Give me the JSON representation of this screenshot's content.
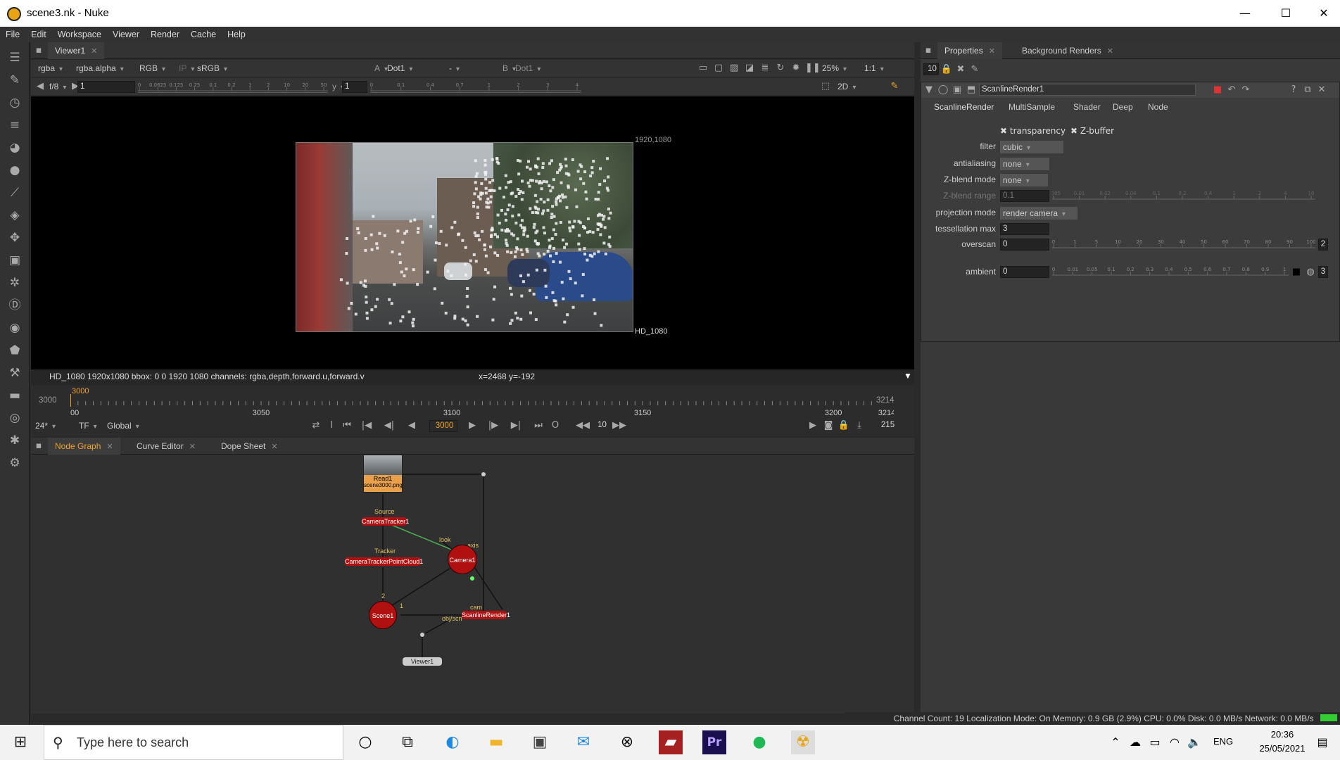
{
  "window": {
    "title": "scene3.nk - Nuke",
    "minimize": "—",
    "maximize": "☐",
    "close": "✕"
  },
  "menu": [
    "File",
    "Edit",
    "Workspace",
    "Viewer",
    "Render",
    "Cache",
    "Help"
  ],
  "viewer_tab": {
    "label": "Viewer1",
    "close": "✕"
  },
  "viewer_controls": {
    "channels": "rgba",
    "alpha": "rgba.alpha",
    "display": "RGB",
    "ip": "IP",
    "lut": "sRGB",
    "a_label": "A",
    "a_input": "Dot1",
    "mid": "-",
    "b_label": "B",
    "b_input": "Dot1",
    "zoom": "25%",
    "ratio": "1:1",
    "fstop": "f/8",
    "gain": "1",
    "gamma_label": "y",
    "gamma": "1",
    "mode": "2D"
  },
  "gain_ticks": [
    "0",
    "0.0625",
    "0.125",
    "0.25",
    "0.1",
    "0.2",
    "1",
    "2",
    "10",
    "20",
    "50"
  ],
  "gamma_ticks": [
    "0",
    "0.1",
    "0.4",
    "0.7",
    "1",
    "2",
    "3",
    "4"
  ],
  "viewer": {
    "res_top": "1920,1080",
    "res_bottom": "HD_1080"
  },
  "status": {
    "info": "HD_1080 1920x1080  bbox: 0 0 1920 1080 channels: rgba,depth,forward.u,forward.v",
    "coords": "x=2468 y=-192"
  },
  "timeline": {
    "start": "3000",
    "end": "3214",
    "current": "3000",
    "ticks": [
      "3000",
      "3050",
      "3100",
      "3150",
      "3200",
      "3214"
    ],
    "fps": "24*",
    "tf": "TF",
    "global": "Global",
    "frame": "3000",
    "step": "10",
    "total": "215",
    "in_marker": "I",
    "out_marker": "O"
  },
  "graph_tabs": [
    {
      "label": "Node Graph",
      "close": "✕"
    },
    {
      "label": "Curve Editor",
      "close": "✕"
    },
    {
      "label": "Dope Sheet",
      "close": "✕"
    }
  ],
  "nodes": {
    "read": "Read1",
    "read_file": "scene3000.png",
    "tracker": "CameraTracker1",
    "pointcloud": "CameraTrackerPointCloud1",
    "camera": "Camera1",
    "scene": "Scene1",
    "render": "ScanlineRender1",
    "viewer": "Viewer1",
    "lbl_source": "Source",
    "lbl_tracker": "Tracker",
    "lbl_look": "look",
    "lbl_axis": "axis",
    "lbl_cam": "cam",
    "lbl_obj": "obj/scn",
    "lbl_2": "2",
    "lbl_1": "1"
  },
  "props_tabs": [
    {
      "label": "Properties",
      "close": "✕"
    },
    {
      "label": "Background Renders",
      "close": "✕"
    }
  ],
  "props": {
    "max_panels": "10",
    "node_name": "ScanlineRender1",
    "tabs": [
      "ScanlineRender",
      "MultiSample",
      "Shader",
      "Deep",
      "Node"
    ],
    "transparency": "transparency",
    "zbuffer": "Z-buffer",
    "filter_label": "filter",
    "filter": "cubic",
    "antialiasing_label": "antialiasing",
    "antialiasing": "none",
    "zblend_mode_label": "Z-blend mode",
    "zblend_mode": "none",
    "zblend_range_label": "Z-blend range",
    "zblend_range": "0.1",
    "projection_label": "projection mode",
    "projection": "render camera",
    "tess_label": "tessellation max",
    "tess": "3",
    "overscan_label": "overscan",
    "overscan": "0",
    "overscan_count": "2",
    "ambient_label": "ambient",
    "ambient": "0",
    "ambient_count": "3"
  },
  "zblend_ticks": [
    "0.005",
    "0.01",
    "0.02",
    "0.04",
    "0.1",
    "0.2",
    "0.4",
    "1",
    "2",
    "4",
    "10"
  ],
  "overscan_ticks": [
    "0",
    "1",
    "5",
    "10",
    "20",
    "30",
    "40",
    "50",
    "60",
    "70",
    "80",
    "90",
    "100"
  ],
  "ambient_ticks": [
    "0",
    "0.01",
    "0.05",
    "0.1",
    "0.2",
    "0.3",
    "0.4",
    "0.5",
    "0.6",
    "0.7",
    "0.8",
    "0.9",
    "1"
  ],
  "sysstatus": "Channel Count: 19  Localization Mode: On  Memory: 0.9 GB (2.9%)  CPU: 0.0%  Disk: 0.0 MB/s  Network: 0.0 MB/s",
  "taskbar": {
    "search": "Type here to search",
    "lang": "ENG",
    "time": "20:36",
    "date": "25/05/2021",
    "pr": "Pr"
  },
  "colors": {
    "accent": "#f0a030",
    "node_red": "#b01010",
    "spotify": "#1db954"
  }
}
